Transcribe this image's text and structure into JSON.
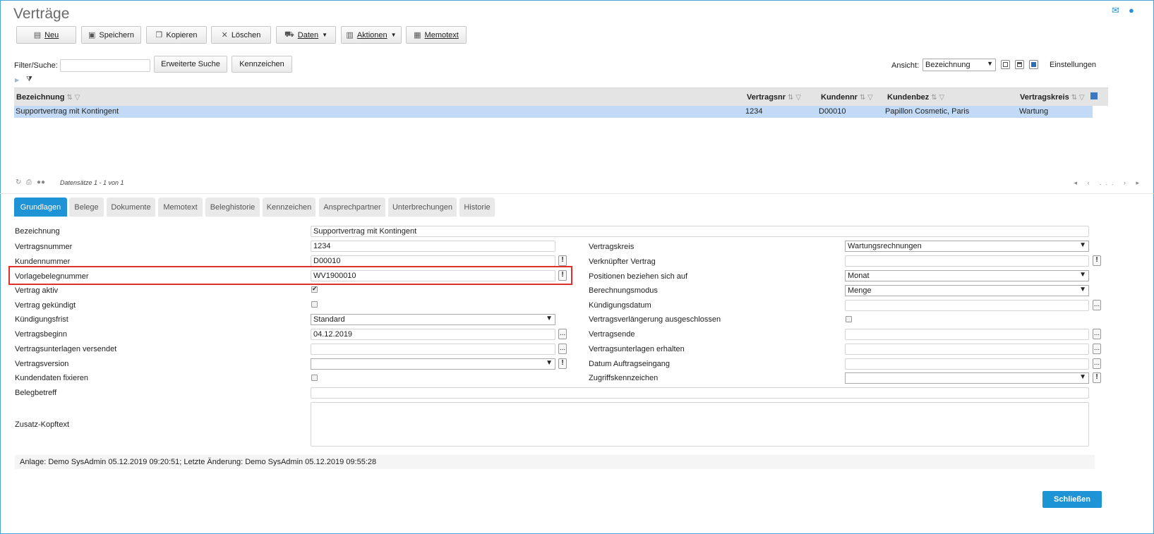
{
  "window": {
    "title": "Verträge"
  },
  "top_icons": [
    "mail-icon",
    "help-icon"
  ],
  "toolbar": {
    "new": "Neu",
    "save": "Speichern",
    "copy": "Kopieren",
    "delete": "Löschen",
    "data": "Daten",
    "actions": "Aktionen",
    "memo": "Memotext"
  },
  "filter": {
    "label": "Filter/Suche:",
    "value": "",
    "advanced_search": "Erweiterte Suche",
    "tags": "Kennzeichen",
    "view_label": "Ansicht:",
    "view_value": "Bezeichnung",
    "settings": "Einstellungen"
  },
  "grid": {
    "columns": [
      "Bezeichnung",
      "Vertragsnr",
      "Kundennr",
      "Kundenbez",
      "Vertragskreis"
    ],
    "rows": [
      [
        "Supportvertrag mit Kontingent",
        "1234",
        "D00010",
        "Papillon Cosmetic, Paris",
        "Wartung"
      ]
    ],
    "records_info": "Datensätze 1 - 1 von 1",
    "pager": "◂ ‹ ... › ▸"
  },
  "tabs": [
    "Grundlagen",
    "Belege",
    "Dokumente",
    "Memotext",
    "Beleghistorie",
    "Kennzeichen",
    "Ansprechpartner",
    "Unterbrechungen",
    "Historie"
  ],
  "form": {
    "bezeichnung": {
      "label": "Bezeichnung",
      "value": "Supportvertrag mit Kontingent"
    },
    "vertragsnummer": {
      "label": "Vertragsnummer",
      "value": "1234"
    },
    "kundennummer": {
      "label": "Kundennummer",
      "value": "D00010"
    },
    "vorlagebelegnummer": {
      "label": "Vorlagebelegnummer",
      "value": "WV1900010"
    },
    "vertrag_aktiv": {
      "label": "Vertrag aktiv",
      "checked": true
    },
    "vertrag_gekuendigt": {
      "label": "Vertrag gekündigt",
      "checked": false
    },
    "kuendigungsfrist": {
      "label": "Kündigungsfrist",
      "value": "Standard"
    },
    "vertragsbeginn": {
      "label": "Vertragsbeginn",
      "value": "04.12.2019"
    },
    "unterlagen_versendet": {
      "label": "Vertragsunterlagen versendet",
      "value": ""
    },
    "vertragsversion": {
      "label": "Vertragsversion",
      "value": ""
    },
    "kundendaten_fixieren": {
      "label": "Kundendaten fixieren",
      "checked": false
    },
    "belegbetreff": {
      "label": "Belegbetreff",
      "value": ""
    },
    "zusatz_kopftext": {
      "label": "Zusatz-Kopftext",
      "value": ""
    },
    "vertragskreis": {
      "label": "Vertragskreis",
      "value": "Wartungsrechnungen"
    },
    "verknuepfter_vertrag": {
      "label": "Verknüpfter Vertrag",
      "value": ""
    },
    "positionen_beziehen": {
      "label": "Positionen beziehen sich auf",
      "value": "Monat"
    },
    "berechnungsmodus": {
      "label": "Berechnungsmodus",
      "value": "Menge"
    },
    "kuendigungsdatum": {
      "label": "Kündigungsdatum",
      "value": ""
    },
    "verlaengerung_ausgeschlossen": {
      "label": "Vertragsverlängerung ausgeschlossen",
      "checked": false
    },
    "vertragsende": {
      "label": "Vertragsende",
      "value": ""
    },
    "unterlagen_erhalten": {
      "label": "Vertragsunterlagen erhalten",
      "value": ""
    },
    "datum_auftragseingang": {
      "label": "Datum Auftragseingang",
      "value": ""
    },
    "zugriffskennzeichen": {
      "label": "Zugriffskennzeichen",
      "value": ""
    }
  },
  "footer": {
    "info": "Anlage: Demo SysAdmin 05.12.2019 09:20:51; Letzte Änderung: Demo SysAdmin 05.12.2019 09:55:28",
    "close": "Schließen"
  },
  "glyphs": {
    "ellipsis": "...",
    "alert": "!",
    "dropdown": "▼"
  }
}
